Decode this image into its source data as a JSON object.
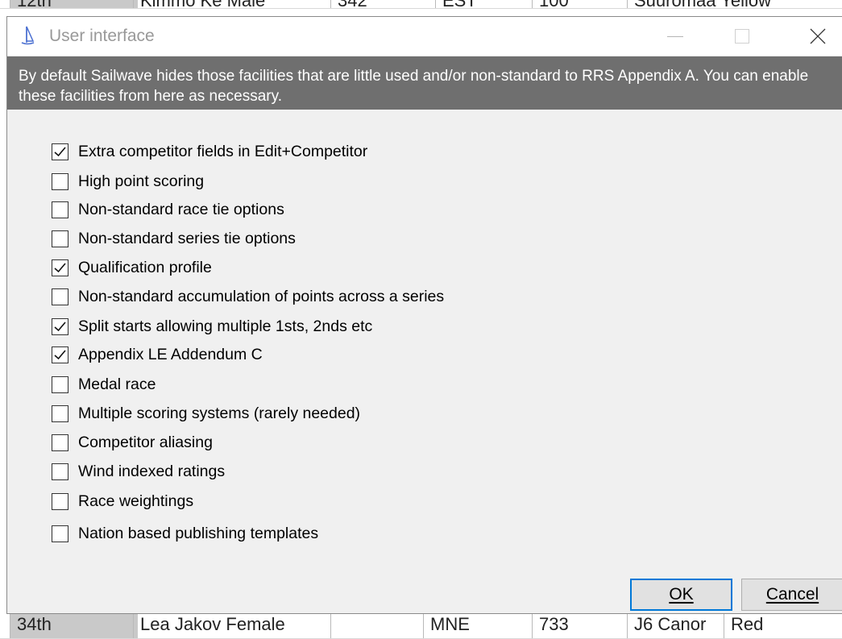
{
  "background": {
    "top_row": [
      "12th",
      "Kimmo Ke Male",
      "342",
      "EST",
      "100",
      "Suuromaa Yellow"
    ],
    "bottom_row": [
      "34th",
      "Lea Jakov Female",
      "",
      "MNE",
      "733",
      "J6 Canor",
      "Red"
    ]
  },
  "dialog": {
    "title": "User interface",
    "banner_text": "By default Sailwave hides those facilities that are little used and/or non-standard to RRS Appendix A.  You can enable these facilities from here as necessary.",
    "options": [
      {
        "label": "Extra competitor fields in Edit+Competitor",
        "checked": true
      },
      {
        "label": "High point scoring",
        "checked": false
      },
      {
        "label": "Non-standard race tie options",
        "checked": false
      },
      {
        "label": "Non-standard series tie options",
        "checked": false
      },
      {
        "label": "Qualification profile",
        "checked": true
      },
      {
        "label": "Non-standard accumulation of points across a series",
        "checked": false
      },
      {
        "label": "Split starts allowing multiple 1sts, 2nds etc",
        "checked": true
      },
      {
        "label": "Appendix LE Addendum C",
        "checked": true
      },
      {
        "label": "Medal race",
        "checked": false
      },
      {
        "label": "Multiple scoring systems (rarely needed)",
        "checked": false
      },
      {
        "label": "Competitor aliasing",
        "checked": false
      },
      {
        "label": "Wind indexed ratings",
        "checked": false
      },
      {
        "label": "Race weightings",
        "checked": false
      },
      {
        "label": "Nation based publishing templates",
        "checked": false
      }
    ],
    "ok_label": "OK",
    "cancel_label": "Cancel",
    "accent_color": "#0078d7",
    "banner_color": "#6f6f6f"
  }
}
